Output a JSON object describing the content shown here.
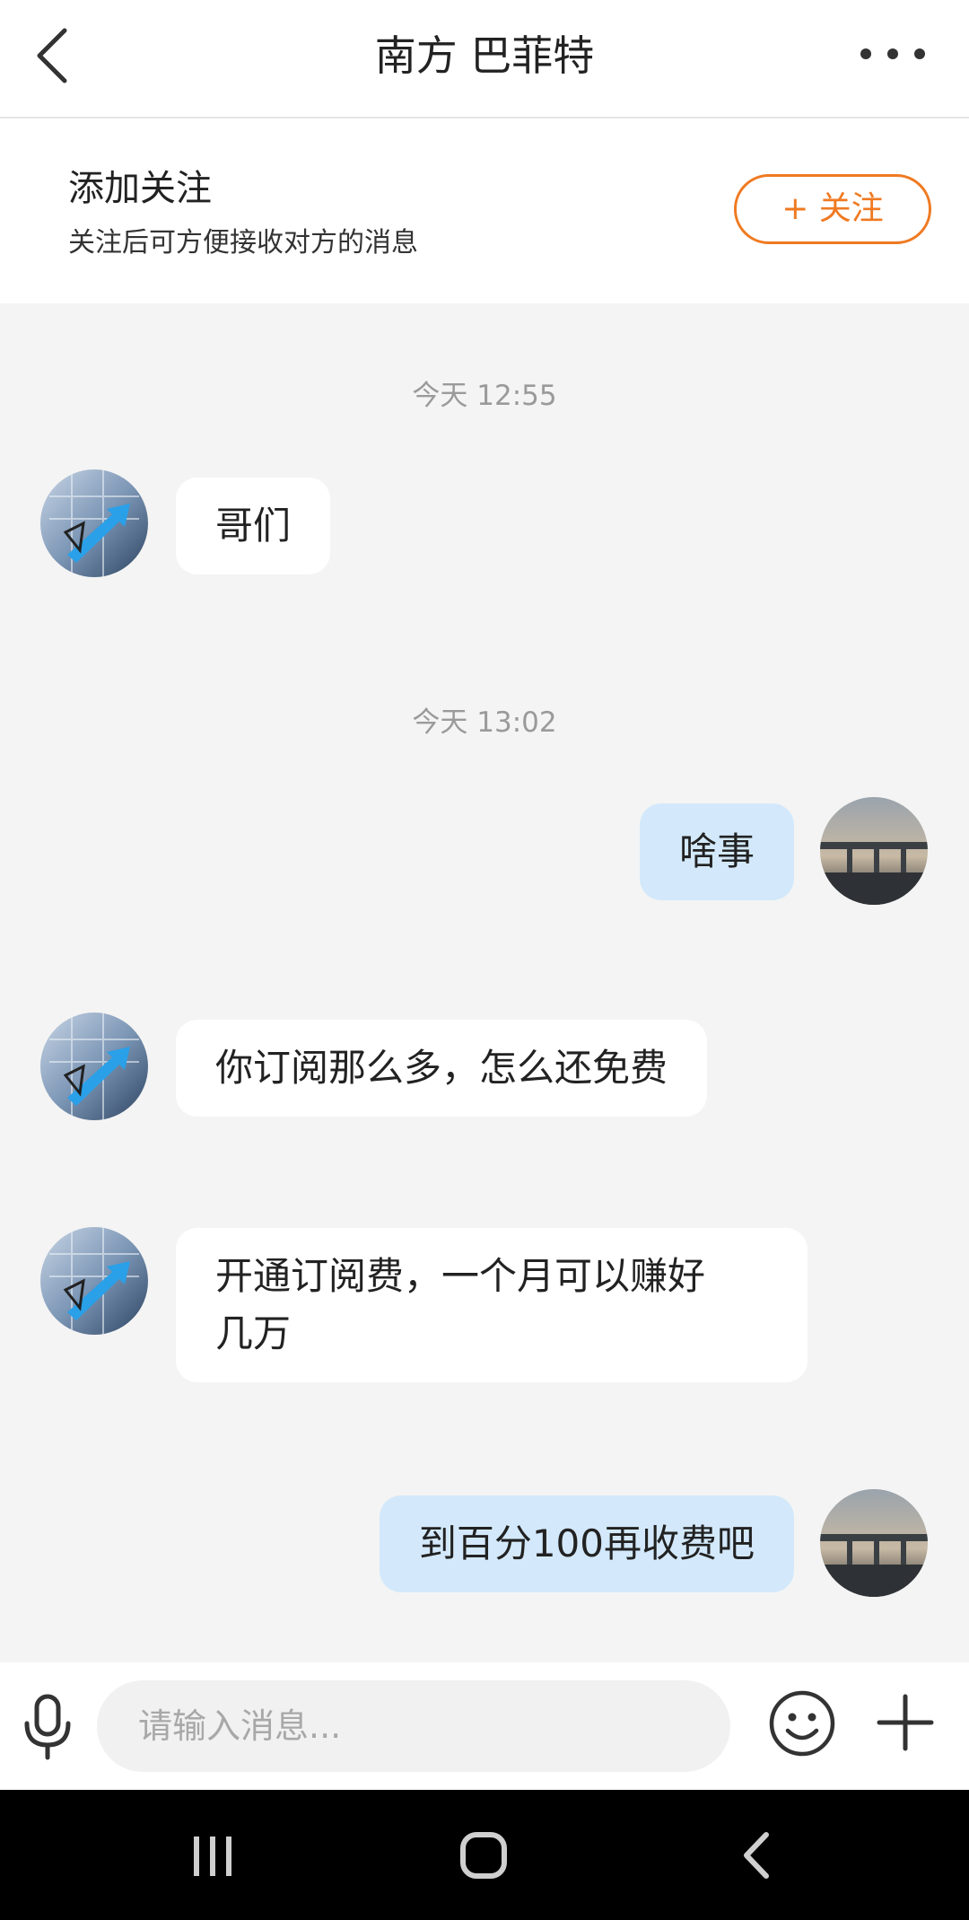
{
  "header": {
    "title": "南方 巴菲特"
  },
  "follow_bar": {
    "title": "添加关注",
    "subtitle": "关注后可方便接收对方的消息",
    "button_label": "+ 关注"
  },
  "messages": [
    {
      "type": "time",
      "text": "今天 12:55"
    },
    {
      "type": "incoming",
      "text": "哥们"
    },
    {
      "type": "time",
      "text": "今天 13:02"
    },
    {
      "type": "outgoing",
      "text": "啥事"
    },
    {
      "type": "incoming",
      "text": "你订阅那么多，怎么还免费"
    },
    {
      "type": "incoming",
      "text": "开通订阅费，一个月可以赚好\n几万"
    },
    {
      "type": "outgoing",
      "text": "到百分100再收费吧"
    }
  ],
  "input_bar": {
    "placeholder": "请输入消息..."
  },
  "icons": {
    "back": "chevron-left-icon",
    "more": "more-dots-icon",
    "mic": "microphone-icon",
    "emoji": "smiley-icon",
    "plus": "plus-icon",
    "nav_recent": "recent-apps-icon",
    "nav_home": "home-icon",
    "nav_back": "back-icon"
  },
  "colors": {
    "accent": "#ef7a22",
    "outgoing_bubble": "#d3e9fb",
    "incoming_bubble": "#ffffff",
    "background": "#f4f4f4"
  }
}
